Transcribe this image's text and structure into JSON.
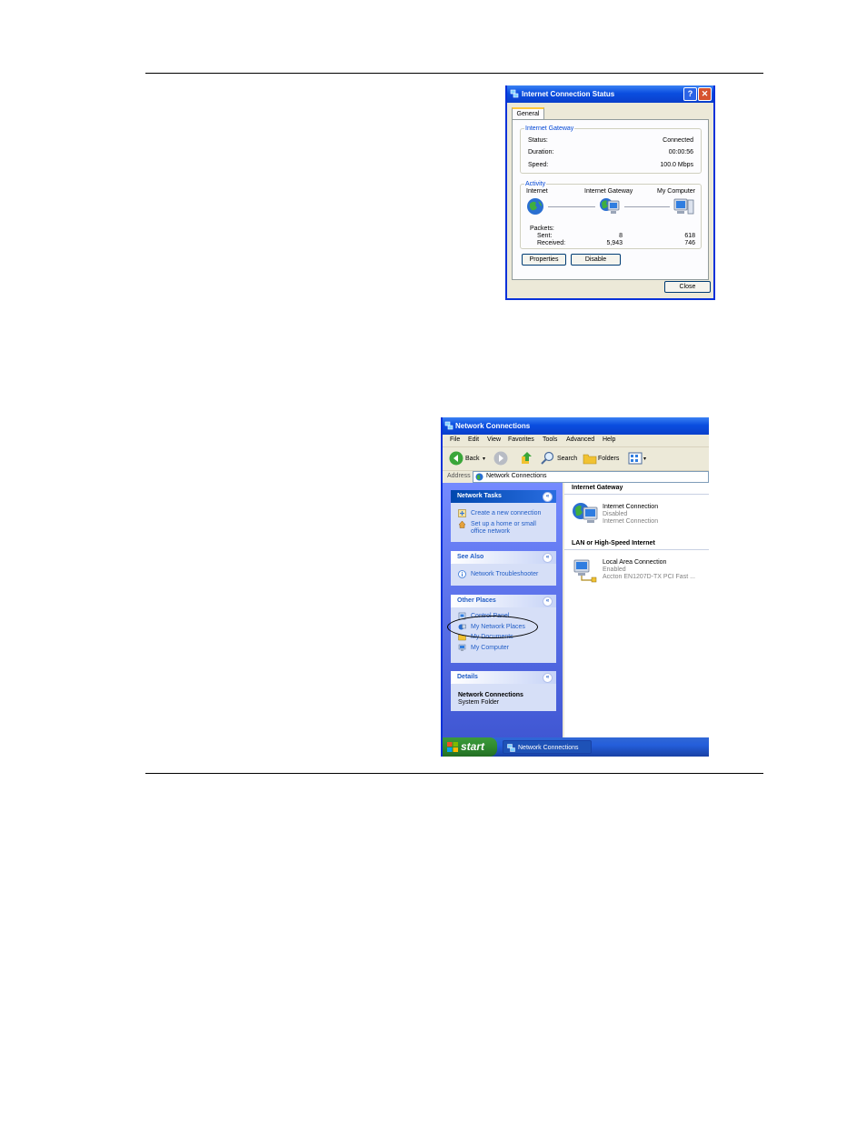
{
  "status_dialog": {
    "title": "Internet Connection Status",
    "help_glyph": "?",
    "close_glyph": "✕",
    "tab": "General",
    "gateway_legend": "Internet Gateway",
    "status_label": "Status:",
    "status_value": "Connected",
    "duration_label": "Duration:",
    "duration_value": "00:00:56",
    "speed_label": "Speed:",
    "speed_value": "100.0 Mbps",
    "activity_legend": "Activity",
    "node_internet": "Internet",
    "node_gateway": "Internet Gateway",
    "node_computer": "My Computer",
    "packets_label": "Packets:",
    "sent_label": "Sent:",
    "received_label": "Received:",
    "sent_internet": "8",
    "received_internet": "5,943",
    "sent_computer": "618",
    "received_computer": "746",
    "properties_button": "Properties",
    "disable_button": "Disable",
    "close_button": "Close"
  },
  "network_window": {
    "title": "Network Connections",
    "menu": [
      "File",
      "Edit",
      "View",
      "Favorites",
      "Tools",
      "Advanced",
      "Help"
    ],
    "toolbar": {
      "back": "Back",
      "search": "Search",
      "folders": "Folders"
    },
    "address_label": "Address",
    "address_value": "Network Connections",
    "tasks": {
      "network_tasks_title": "Network Tasks",
      "create_connection": "Create a new connection",
      "home_network_1": "Set up a home or small",
      "home_network_2": "office network",
      "see_also_title": "See Also",
      "troubleshooter": "Network Troubleshooter",
      "other_places_title": "Other Places",
      "control_panel": "Control Panel",
      "my_network_places": "My Network Places",
      "my_documents": "My Documents",
      "my_computer": "My Computer",
      "details_title": "Details",
      "details_name": "Network Connections",
      "details_type": "System Folder"
    },
    "sections": {
      "gateway_header": "Internet Gateway",
      "gateway_name": "Internet Connection",
      "gateway_status": "Disabled",
      "gateway_type": "Internet Connection",
      "lan_header": "LAN or High-Speed Internet",
      "lan_name": "Local Area Connection",
      "lan_status": "Enabled",
      "lan_device": "Accton EN1207D-TX PCI Fast ..."
    },
    "taskbar": {
      "start": "start",
      "task_button": "Network Connections"
    },
    "chevron_glyph": "«"
  }
}
